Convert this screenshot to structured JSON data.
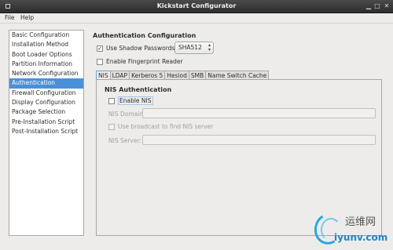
{
  "window": {
    "title": "Kickstart Configurator"
  },
  "menubar": {
    "file": "File",
    "help": "Help"
  },
  "sidebar": {
    "items": [
      {
        "label": "Basic Configuration"
      },
      {
        "label": "Installation Method"
      },
      {
        "label": "Boot Loader Options"
      },
      {
        "label": "Partition Information"
      },
      {
        "label": "Network Configuration"
      },
      {
        "label": "Authentication",
        "selected": true
      },
      {
        "label": "Firewall Configuration"
      },
      {
        "label": "Display Configuration"
      },
      {
        "label": "Package Selection"
      },
      {
        "label": "Pre-Installation Script"
      },
      {
        "label": "Post-Installation Script"
      }
    ]
  },
  "auth": {
    "title": "Authentication Configuration",
    "shadow_label": "Use Shadow Passwords",
    "shadow_checked": true,
    "hash_value": "SHA512",
    "fingerprint_label": "Enable Fingerprint Reader",
    "fingerprint_checked": false
  },
  "tabs": [
    "NIS",
    "LDAP",
    "Kerberos 5",
    "Hesiod",
    "SMB",
    "Name Switch Cache"
  ],
  "active_tab": "NIS",
  "nis": {
    "title": "NIS Authentication",
    "enable_label": "Enable NIS",
    "domain_label": "NIS Domain:",
    "domain_value": "",
    "broadcast_label": "Use broadcast to find NIS server",
    "server_label": "NIS Server:",
    "server_value": ""
  },
  "watermark": {
    "line1": "运维网",
    "line2": "iyunv.com"
  },
  "colors": {
    "selection": "#4a90d9",
    "titlebar": "#2d2d2d",
    "window_bg": "#edeceb"
  }
}
